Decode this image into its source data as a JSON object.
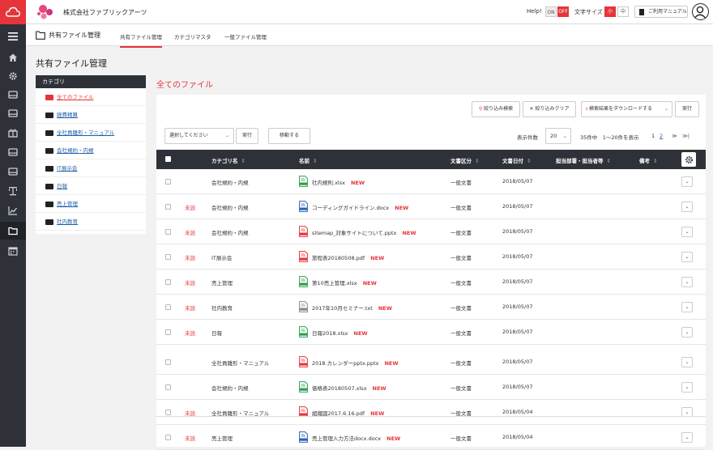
{
  "header": {
    "company": "株式会社ファブリックアーツ",
    "help_label": "Help!",
    "help_on": "ON",
    "help_off": "OFF",
    "fontsize_label": "文字サイズ",
    "fontsize_small": "小",
    "fontsize_medium": "中",
    "manual_label": "ご利用マニュアル"
  },
  "sidebar": {
    "icons": [
      "menu-icon",
      "home-icon",
      "gear-icon",
      "hdd-icon",
      "hdd-icon",
      "gift-icon",
      "hdd-icon",
      "hdd-icon",
      "balance-icon",
      "chart-icon",
      "folder-icon",
      "calendar-icon"
    ]
  },
  "subnav": {
    "title": "共有ファイル管理",
    "tabs": [
      "共有ファイル管理",
      "カテゴリマスタ",
      "一般ファイル管理"
    ]
  },
  "page_title": "共有ファイル管理",
  "categories": {
    "header": "カテゴリ",
    "items": [
      "全てのファイル",
      "経費精算",
      "全社員雛形・マニュアル",
      "会社規約・内規",
      "IT展示会",
      "日報",
      "売上管理",
      "社内教育"
    ]
  },
  "main": {
    "section_title": "全てのファイル",
    "filter_search": "絞り込み検索",
    "filter_clear": "絞り込みクリア",
    "download_label": "検索結果をダウンロードする",
    "execute": "実行",
    "select_placeholder": "選択してください",
    "execute2": "実行",
    "move": "移動する",
    "per_page_label": "表示件数",
    "per_page": "20",
    "count_info": "35件中　1〜20件を表示",
    "pages": [
      "1",
      "2"
    ],
    "page_next": "≫",
    "page_last": "≫|"
  },
  "table": {
    "headers": {
      "category": "カテゴリ名",
      "name": "名前",
      "doc_type": "文書区分",
      "doc_date": "文書日付",
      "owner": "担当部署・担当者等",
      "note": "備考"
    },
    "rows": [
      {
        "unread": "",
        "category": "会社規約・内規",
        "icon": "xlsx",
        "name": "社内規則.xlsx",
        "new": "NEW",
        "doc_type": "一般文書",
        "date": "2018/05/07"
      },
      {
        "unread": "未読",
        "category": "会社規約・内規",
        "icon": "docx",
        "name": "コーディングガイドライン.docx",
        "new": "NEW",
        "doc_type": "一般文書",
        "date": "2018/05/07"
      },
      {
        "unread": "未読",
        "category": "会社規約・内規",
        "icon": "pptx",
        "name": "sitemap_対象サイトについて.pptx",
        "new": "NEW",
        "doc_type": "一般文書",
        "date": "2018/05/07"
      },
      {
        "unread": "未読",
        "category": "IT展示会",
        "icon": "pdf",
        "name": "旅程表20180508.pdf",
        "new": "NEW",
        "doc_type": "一般文書",
        "date": "2018/05/07"
      },
      {
        "unread": "未読",
        "category": "売上管理",
        "icon": "xlsx",
        "name": "第10売上管理.xlsx",
        "new": "NEW",
        "doc_type": "一般文書",
        "date": "2018/05/07"
      },
      {
        "unread": "未読",
        "category": "社内教育",
        "icon": "txt",
        "name": "2017年10月セミナー.txt",
        "new": "NEW",
        "doc_type": "一般文書",
        "date": "2018/05/07"
      },
      {
        "unread": "未読",
        "category": "日報",
        "icon": "xlsx",
        "name": "日報2018.xlsx",
        "new": "NEW",
        "doc_type": "一般文書",
        "date": "2018/05/07"
      },
      {
        "unread": "",
        "category": "全社員雛形・マニュアル",
        "icon": "pptx",
        "name": "2018.カレンダーpptx.pptx",
        "new": "NEW",
        "doc_type": "一般文書",
        "date": "2018/05/07"
      },
      {
        "unread": "",
        "category": "会社規約・内規",
        "icon": "xlsx",
        "name": "価格表20180507.xlsx",
        "new": "NEW",
        "doc_type": "一般文書",
        "date": "2018/05/07"
      },
      {
        "unread": "未読",
        "category": "全社員雛形・マニュアル",
        "icon": "pdf",
        "name": "組織図2017.6.16.pdf",
        "new": "NEW",
        "doc_type": "一般文書",
        "date": "2018/05/04"
      },
      {
        "unread": "未読",
        "category": "売上管理",
        "icon": "docx",
        "name": "売上管理入力方法docx.docx",
        "new": "NEW",
        "doc_type": "一般文書",
        "date": "2018/05/04"
      }
    ]
  },
  "colors": {
    "accent": "#e5353a",
    "dark": "#2e3238",
    "link": "#1f5fa8",
    "xlsx": "#2e9e4f",
    "docx": "#2b63b8",
    "pptx": "#e5353a",
    "pdf": "#e5353a",
    "txt": "#888888"
  }
}
